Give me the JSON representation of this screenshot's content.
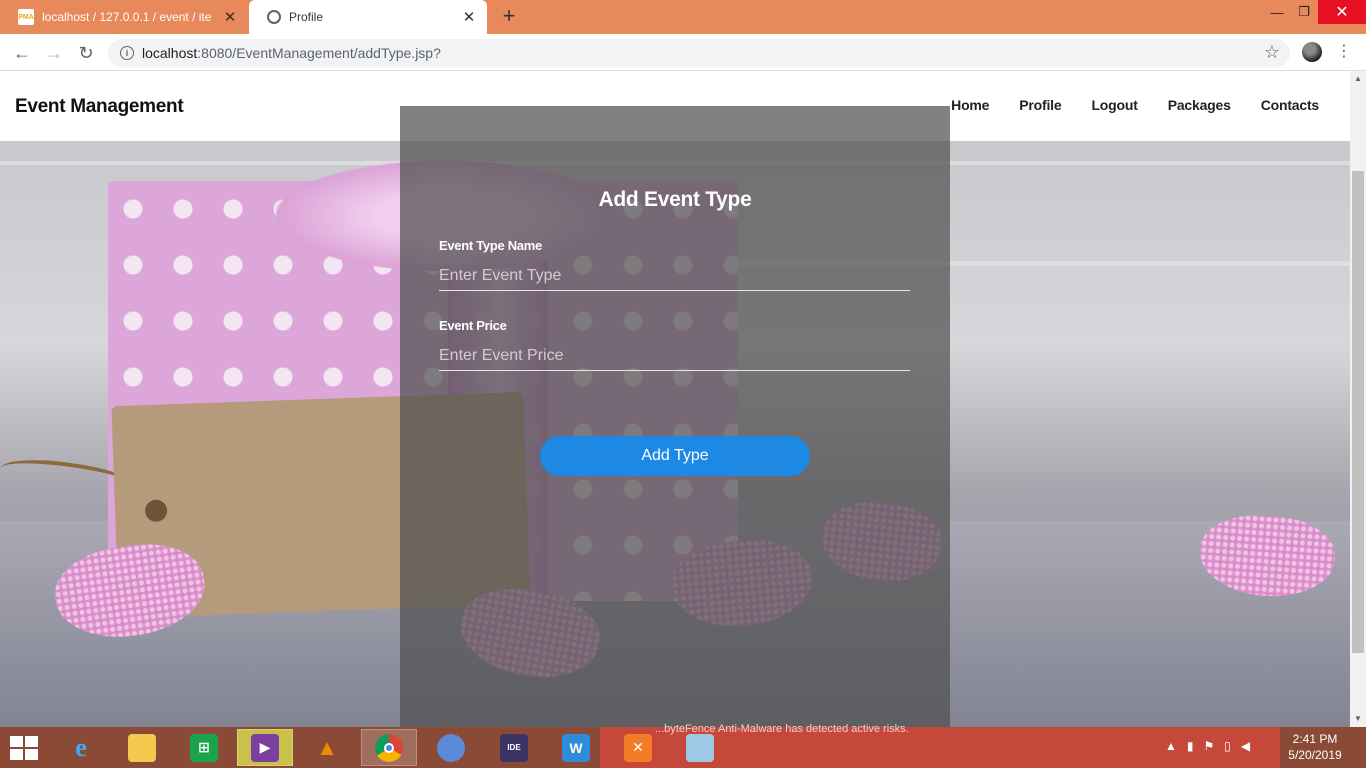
{
  "browser": {
    "tabs": [
      {
        "title": "localhost / 127.0.0.1 / event / ite",
        "favicon": "PMA"
      },
      {
        "title": "Profile"
      }
    ],
    "url_host": "localhost",
    "url_path": ":8080/EventManagement/addType.jsp?"
  },
  "site": {
    "brand": "Event Management",
    "nav": [
      "Home",
      "Profile",
      "Logout",
      "Packages",
      "Contacts"
    ]
  },
  "form": {
    "title": "Add Event Type",
    "type_label": "Event Type Name",
    "type_placeholder": "Enter Event Type",
    "price_label": "Event Price",
    "price_placeholder": "Enter Event Price",
    "submit_label": "Add Type",
    "button_color": "#1e88e5"
  },
  "taskbar": {
    "notification": "...byteFence Anti-Malware has detected active risks.",
    "time": "2:41 PM",
    "date": "5/20/2019",
    "apps": [
      "internet-explorer-icon",
      "file-explorer-icon",
      "store-icon",
      "visual-studio-icon",
      "vlc-icon",
      "chrome-icon",
      "chromium-icon",
      "eclipse-java-ee-icon",
      "wps-office-icon",
      "xampp-icon",
      "notepad-icon"
    ]
  }
}
